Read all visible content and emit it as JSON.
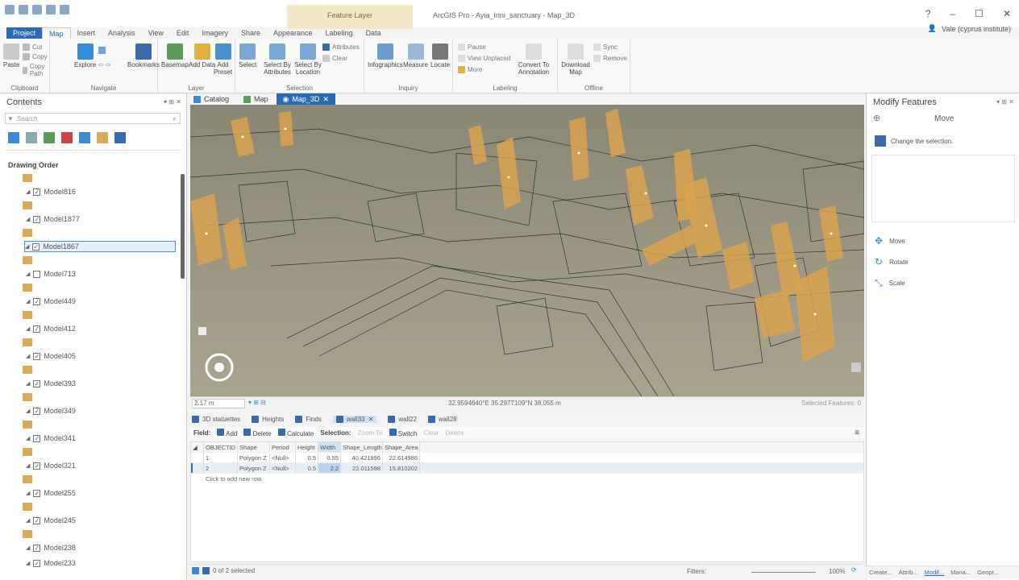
{
  "app": {
    "title": "ArcGIS Pro - Ayia_Irini_sanctuary - Map_3D",
    "context_label": "Feature Layer",
    "user": "Vale (cyprus institute)",
    "window": {
      "help": "?",
      "minimize": "–",
      "restore": "☐",
      "close": "✕"
    }
  },
  "tabs": [
    {
      "label": "Project"
    },
    {
      "label": "Map"
    },
    {
      "label": "Insert"
    },
    {
      "label": "Analysis"
    },
    {
      "label": "View"
    },
    {
      "label": "Edit"
    },
    {
      "label": "Imagery"
    },
    {
      "label": "Share"
    },
    {
      "label": "Appearance"
    },
    {
      "label": "Labeling"
    },
    {
      "label": "Data"
    }
  ],
  "ribbon": {
    "clipboard": {
      "label": "Clipboard",
      "paste": "Paste",
      "cut": "Cut",
      "copy": "Copy",
      "copy_path": "Copy Path"
    },
    "navigate": {
      "label": "Navigate",
      "explore": "Explore",
      "bookmarks": "Bookmarks"
    },
    "layer": {
      "label": "Layer",
      "basemap": "Basemap",
      "add_data": "Add Data",
      "add_preset": "Add Preset"
    },
    "selection": {
      "label": "Selection",
      "select": "Select",
      "by_attr": "Select By Attributes",
      "by_loc": "Select By Location",
      "attributes": "Attributes",
      "clear": "Clear"
    },
    "inquiry": {
      "label": "Inquiry",
      "infographics": "Infographics",
      "measure": "Measure",
      "locate": "Locate"
    },
    "labeling": {
      "label": "Labeling",
      "pause": "Pause",
      "view_unplaced": "View Unplaced",
      "more": "More",
      "convert": "Convert To Annotation"
    },
    "offline": {
      "label": "Offline",
      "download": "Download Map",
      "sync": "Sync",
      "remove": "Remove"
    }
  },
  "contents": {
    "title": "Contents",
    "search_placeholder": "Search",
    "drawing_order": "Drawing Order",
    "layers": [
      {
        "name": "Model816",
        "checked": true
      },
      {
        "name": "Model1877",
        "checked": true
      },
      {
        "name": "Model1867",
        "checked": true,
        "selected": true
      },
      {
        "name": "Model713",
        "checked": false
      },
      {
        "name": "Model449",
        "checked": true
      },
      {
        "name": "Model412",
        "checked": true
      },
      {
        "name": "Model405",
        "checked": true
      },
      {
        "name": "Model393",
        "checked": true
      },
      {
        "name": "Model349",
        "checked": true
      },
      {
        "name": "Model341",
        "checked": true
      },
      {
        "name": "Model321",
        "checked": true
      },
      {
        "name": "Model255",
        "checked": true
      },
      {
        "name": "Model245",
        "checked": true
      },
      {
        "name": "Model238",
        "checked": true
      },
      {
        "name": "Model233",
        "checked": true
      }
    ]
  },
  "view_tabs": [
    {
      "label": "Catalog"
    },
    {
      "label": "Map"
    },
    {
      "label": "Map_3D",
      "active": true
    }
  ],
  "map_status": {
    "scale": "2.17 m",
    "coords": "32.9594640°E 35.2977109°N  38.055 m",
    "selected": "Selected Features: 0"
  },
  "attr_tabs": [
    {
      "label": "3D statuettes"
    },
    {
      "label": "Heights"
    },
    {
      "label": "Finds"
    },
    {
      "label": "wall33",
      "active": true
    },
    {
      "label": "wall22"
    },
    {
      "label": "wall28"
    }
  ],
  "attr_toolbar": {
    "field": "Field:",
    "add": "Add",
    "delete": "Delete",
    "calculate": "Calculate",
    "selection": "Selection:",
    "zoom_to": "Zoom To",
    "switch": "Switch",
    "clear": "Clear",
    "delete2": "Delete"
  },
  "table": {
    "columns": [
      "OBJECTID",
      "Shape",
      "Period",
      "Height",
      "Width",
      "Shape_Length",
      "Shape_Area"
    ],
    "rows": [
      [
        "1",
        "Polygon Z",
        "<Null>",
        "0.5",
        "0.55",
        "40.421896",
        "22.614986"
      ],
      [
        "2",
        "Polygon Z",
        "<Null>",
        "0.5",
        "2.2",
        "22.011598",
        "15.810202"
      ]
    ],
    "add_row": "Click to add new row."
  },
  "bottom_status": {
    "selected": "0 of 2 selected",
    "filters": "Filters:",
    "zoom": "100%"
  },
  "modify": {
    "title": "Modify Features",
    "mode": "Move",
    "change_sel": "Change the selection.",
    "move": "Move",
    "rotate": "Rotate",
    "scale": "Scale"
  },
  "bottom_tabs": [
    {
      "label": "Create..."
    },
    {
      "label": "Attrib..."
    },
    {
      "label": "Modif..."
    },
    {
      "label": "Mana..."
    },
    {
      "label": "Geopr..."
    }
  ],
  "colors": {
    "accent": "#2b6bb3",
    "feature": "#d9aa58"
  }
}
